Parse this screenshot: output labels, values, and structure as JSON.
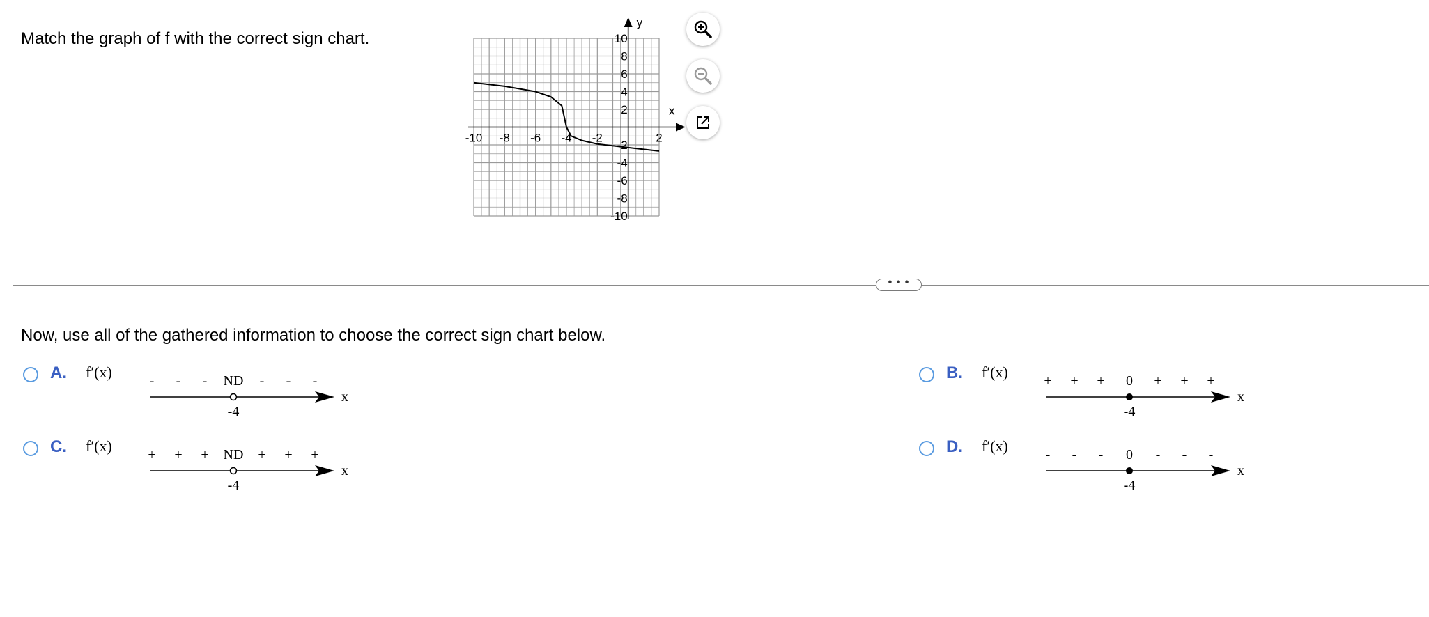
{
  "question": "Match the graph of f with the correct sign chart.",
  "graph": {
    "x_axis_label": "x",
    "y_axis_label": "y",
    "x_tick_labels": [
      "-10",
      "-8",
      "-6",
      "-4",
      "-2",
      "2"
    ],
    "y_tick_labels": [
      "10",
      "8",
      "6",
      "4",
      "2",
      "-2",
      "-4",
      "-6",
      "-8",
      "-10"
    ],
    "xlim": [
      -10,
      2
    ],
    "ylim": [
      -10,
      10
    ],
    "grid": true,
    "curve_points": [
      [
        -10,
        5.0
      ],
      [
        -8,
        4.6
      ],
      [
        -6,
        4.0
      ],
      [
        -5,
        3.4
      ],
      [
        -4.3,
        2.4
      ],
      [
        -4,
        0
      ],
      [
        -3.7,
        -1.0
      ],
      [
        -3,
        -1.5
      ],
      [
        -2,
        -1.9
      ],
      [
        0,
        -2.3
      ],
      [
        2,
        -2.7
      ]
    ],
    "tools": {
      "zoom_in": "zoom-in-icon",
      "zoom_out": "zoom-out-icon",
      "popout": "external-link-icon"
    }
  },
  "more_button": "• • •",
  "instruction": "Now, use all of the gathered information to choose the correct sign chart below.",
  "options": [
    {
      "letter": "A.",
      "label": "f′(x)",
      "signs": [
        "-",
        "-",
        "-",
        "ND",
        "-",
        "-",
        "-"
      ],
      "point_value": "-4",
      "marker": "open",
      "axis_label": "x"
    },
    {
      "letter": "B.",
      "label": "f′(x)",
      "signs": [
        "+",
        "+",
        "+",
        "0",
        "+",
        "+",
        "+"
      ],
      "point_value": "-4",
      "marker": "filled",
      "axis_label": "x"
    },
    {
      "letter": "C.",
      "label": "f′(x)",
      "signs": [
        "+",
        "+",
        "+",
        "ND",
        "+",
        "+",
        "+"
      ],
      "point_value": "-4",
      "marker": "open",
      "axis_label": "x"
    },
    {
      "letter": "D.",
      "label": "f′(x)",
      "signs": [
        "-",
        "-",
        "-",
        "0",
        "-",
        "-",
        "-"
      ],
      "point_value": "-4",
      "marker": "filled",
      "axis_label": "x"
    }
  ],
  "colors": {
    "option_letter": "#3a5fc2",
    "radio_border": "#5a9be0",
    "grid": "#9a9a9a"
  }
}
